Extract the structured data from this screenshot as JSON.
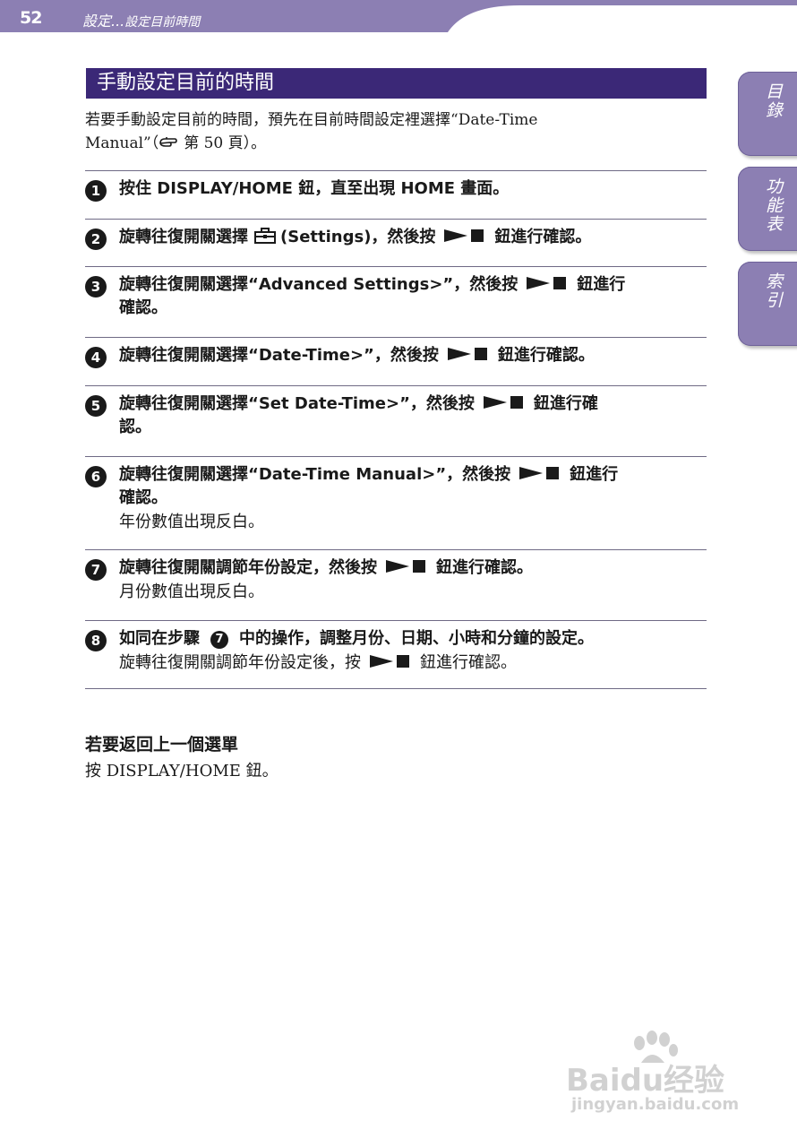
{
  "header": {
    "page_number": "52",
    "breadcrumb_section": "設定...",
    "breadcrumb_page": "設定目前時間",
    "band_color": "#8c7fb3"
  },
  "side_tabs": [
    {
      "label": "目錄"
    },
    {
      "label": "功能表"
    },
    {
      "label": "索引"
    }
  ],
  "section": {
    "title": "手動設定目前的時間",
    "title_bg": "#3b2877",
    "intro_1": "若要手動設定目前的時間，預先在目前時間設定裡選擇“Date-Time",
    "intro_2": "Manual”（",
    "intro_page_ref": "第 50 頁）。",
    "intro_ref_icon": "pointing-hand-icon"
  },
  "steps": [
    {
      "num": "1",
      "text_a": "按住 DISPLAY/HOME 鈕，直至出現 HOME 畫面。"
    },
    {
      "num": "2",
      "text_a": "旋轉往復開關選擇",
      "text_b": "(Settings)，然後按",
      "text_c": "鈕進行確認。",
      "icon": "settings-toolbox-icon"
    },
    {
      "num": "3",
      "text_a": "旋轉往復開關選擇“Advanced Settings>”，然後按",
      "text_c": "鈕進行",
      "text_d": "確認。"
    },
    {
      "num": "4",
      "text_a": "旋轉往復開關選擇“Date-Time>”，然後按",
      "text_c": "鈕進行確認。"
    },
    {
      "num": "5",
      "text_a": "旋轉往復開關選擇“Set Date-Time>”，然後按",
      "text_c": "鈕進行確",
      "text_d": "認。"
    },
    {
      "num": "6",
      "text_a": "旋轉往復開關選擇“Date-Time Manual>”，然後按",
      "text_c": "鈕進行",
      "text_d": "確認。",
      "sub": "年份數值出現反白。"
    },
    {
      "num": "7",
      "text_a": "旋轉往復開關調節年份設定，然後按",
      "text_c": "鈕進行確認。",
      "sub": "月份數值出現反白。"
    },
    {
      "num": "8",
      "text_a": "如同在步驟",
      "ref_num": "7",
      "text_b": "中的操作，調整月份、日期、小時和分鐘的設定。",
      "sub_a": "旋轉往復開關調節年份設定後，按",
      "sub_b": "鈕進行確認。"
    }
  ],
  "return_section": {
    "title": "若要返回上一個選單",
    "body": "按 DISPLAY/HOME 鈕。"
  },
  "watermark": {
    "brand": "Baidu经验",
    "url": "jingyan.baidu.com"
  }
}
